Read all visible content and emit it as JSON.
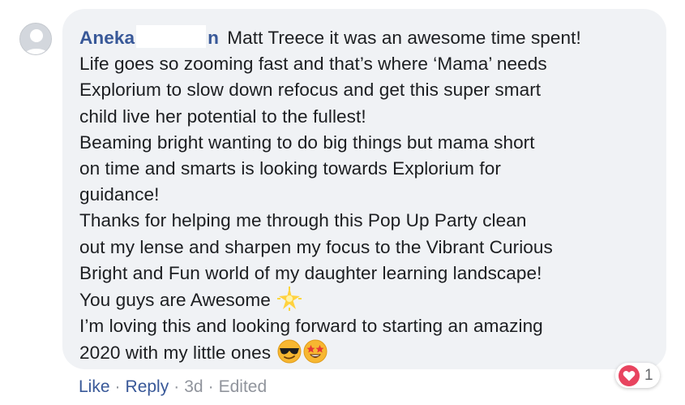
{
  "comment": {
    "author": "Aneka",
    "author_suffix": "n",
    "lines": [
      "Matt Treece it was an awesome time spent!",
      "Life goes so zooming fast and that’s where ‘Mama’ needs",
      "Explorium to slow down refocus and get this super smart",
      "child live her potential to the fullest!",
      "Beaming bright wanting to do big things but mama short",
      "on time and smarts is looking towards Explorium for",
      "guidance!",
      "Thanks for helping me through this Pop Up Party clean",
      "out my lense and sharpen my focus to the Vibrant Curious",
      "Bright and Fun world of my daughter learning landscape!",
      "You guys are Awesome",
      "I’m loving this and looking forward to starting an amazing",
      "2020 with my little ones"
    ],
    "emojis": {
      "line_11": "glowing-star-emoji",
      "line_13": [
        "sunglasses-face-emoji",
        "star-struck-face-emoji"
      ]
    }
  },
  "reactions": {
    "icon": "love-heart-icon",
    "count": "1"
  },
  "actions": {
    "like": "Like",
    "reply": "Reply",
    "time": "3d",
    "edited": "Edited",
    "separator": "·"
  },
  "colors": {
    "link": "#385898",
    "bubble": "#f0f2f5",
    "text": "#1c1e21",
    "meta": "#90949c",
    "love": "#e8445f"
  }
}
